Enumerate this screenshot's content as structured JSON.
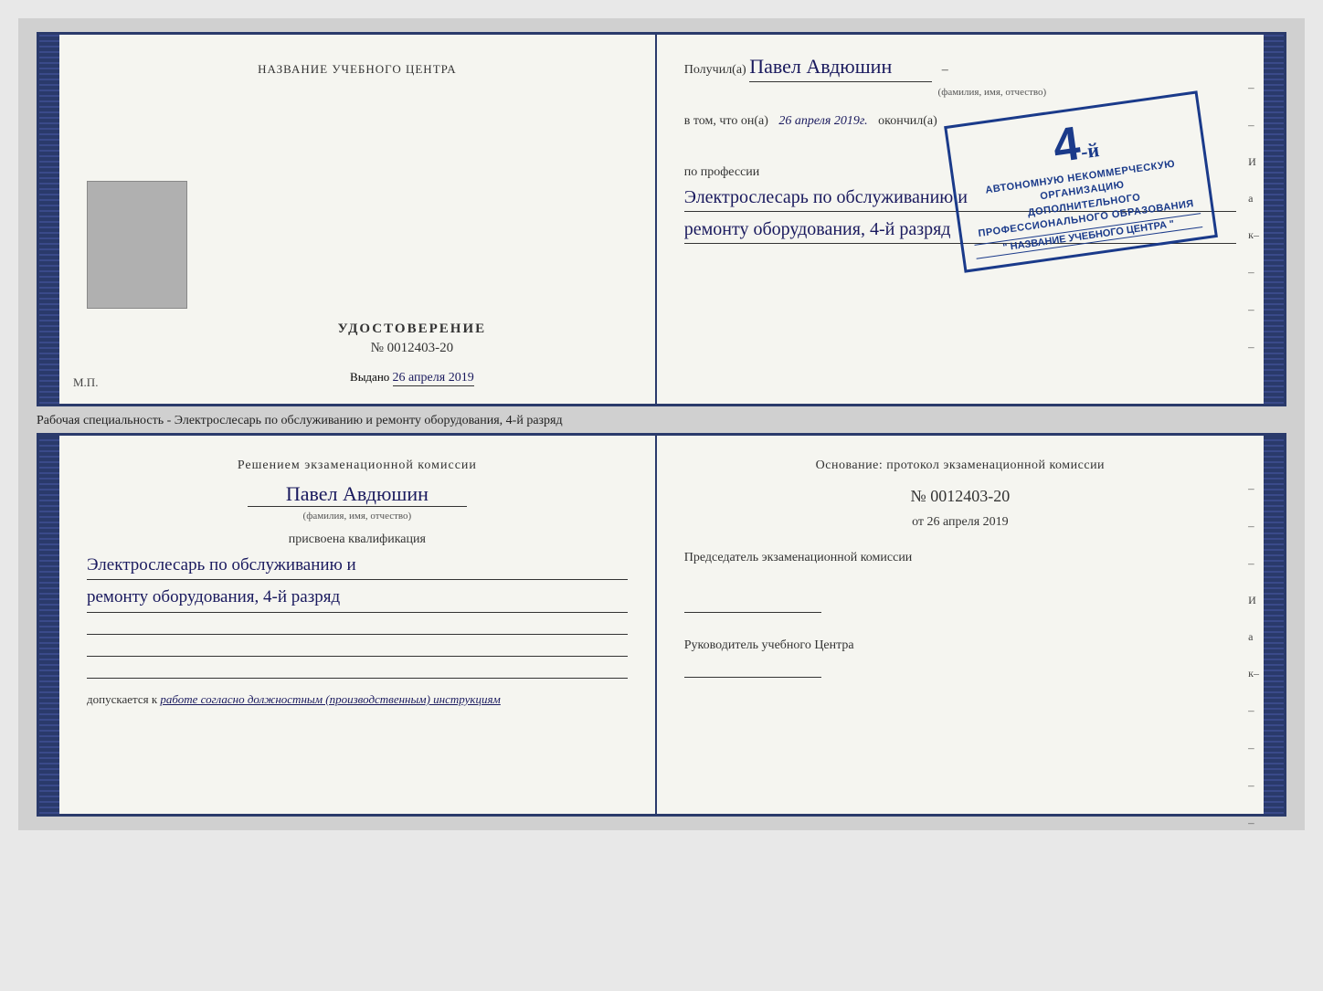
{
  "page": {
    "background_color": "#d0d0d0"
  },
  "top_cert": {
    "left": {
      "training_center_label": "НАЗВАНИЕ УЧЕБНОГО ЦЕНТРА",
      "doc_type": "УДОСТОВЕРЕНИЕ",
      "doc_number_prefix": "№",
      "doc_number": "0012403-20",
      "issued_label": "Выдано",
      "issued_date": "26 апреля 2019",
      "mp_label": "М.П."
    },
    "right": {
      "received_label": "Получил(а)",
      "recipient_name": "Павел Авдюшин",
      "fio_hint": "(фамилия, имя, отчество)",
      "vtom_text": "в том, что он(а)",
      "vtom_date": "26 апреля 2019г.",
      "okonchil": "окончил(а)",
      "stamp_line1": "АВТОНОМНУЮ НЕКОММЕРЧЕСКУЮ ОРГАНИЗАЦИЮ",
      "stamp_line2": "ДОПОЛНИТЕЛЬНОГО ПРОФЕССИОНАЛЬНОГО ОБРАЗОВАНИЯ",
      "stamp_line3": "\" НАЗВАНИЕ УЧЕБНОГО ЦЕНТРА \"",
      "stamp_grade_number": "4",
      "stamp_grade_suffix": "-й",
      "stamp_grade_prefix": "",
      "po_professii": "по профессии",
      "profession_line1": "Электрослесарь по обслуживанию и",
      "profession_line2": "ремонту оборудования, 4-й разряд"
    }
  },
  "separator": {
    "text": "Рабочая специальность - Электрослесарь по обслуживанию и ремонту оборудования, 4-й разряд"
  },
  "bottom_cert": {
    "left": {
      "resheniyem_title": "Решением экзаменационной комиссии",
      "person_name": "Павел Авдюшин",
      "fio_hint": "(фамилия, имя, отчество)",
      "prisvoyena_label": "присвоена квалификация",
      "qualification_line1": "Электрослесарь по обслуживанию и",
      "qualification_line2": "ремонту оборудования, 4-й разряд",
      "dopuskaetsya_label": "допускается к",
      "dopuskaetsya_text": "работе согласно должностным (производственным) инструкциям"
    },
    "right": {
      "osnovaniye_text": "Основание: протокол экзаменационной комиссии",
      "number_prefix": "№",
      "protocol_number": "0012403-20",
      "ot_prefix": "от",
      "ot_date": "26 апреля 2019",
      "chairman_title": "Председатель экзаменационной комиссии",
      "rukovoditel_title": "Руководитель учебного Центра"
    }
  },
  "side_labels": {
    "И": "И",
    "а": "а",
    "к": "к←"
  }
}
